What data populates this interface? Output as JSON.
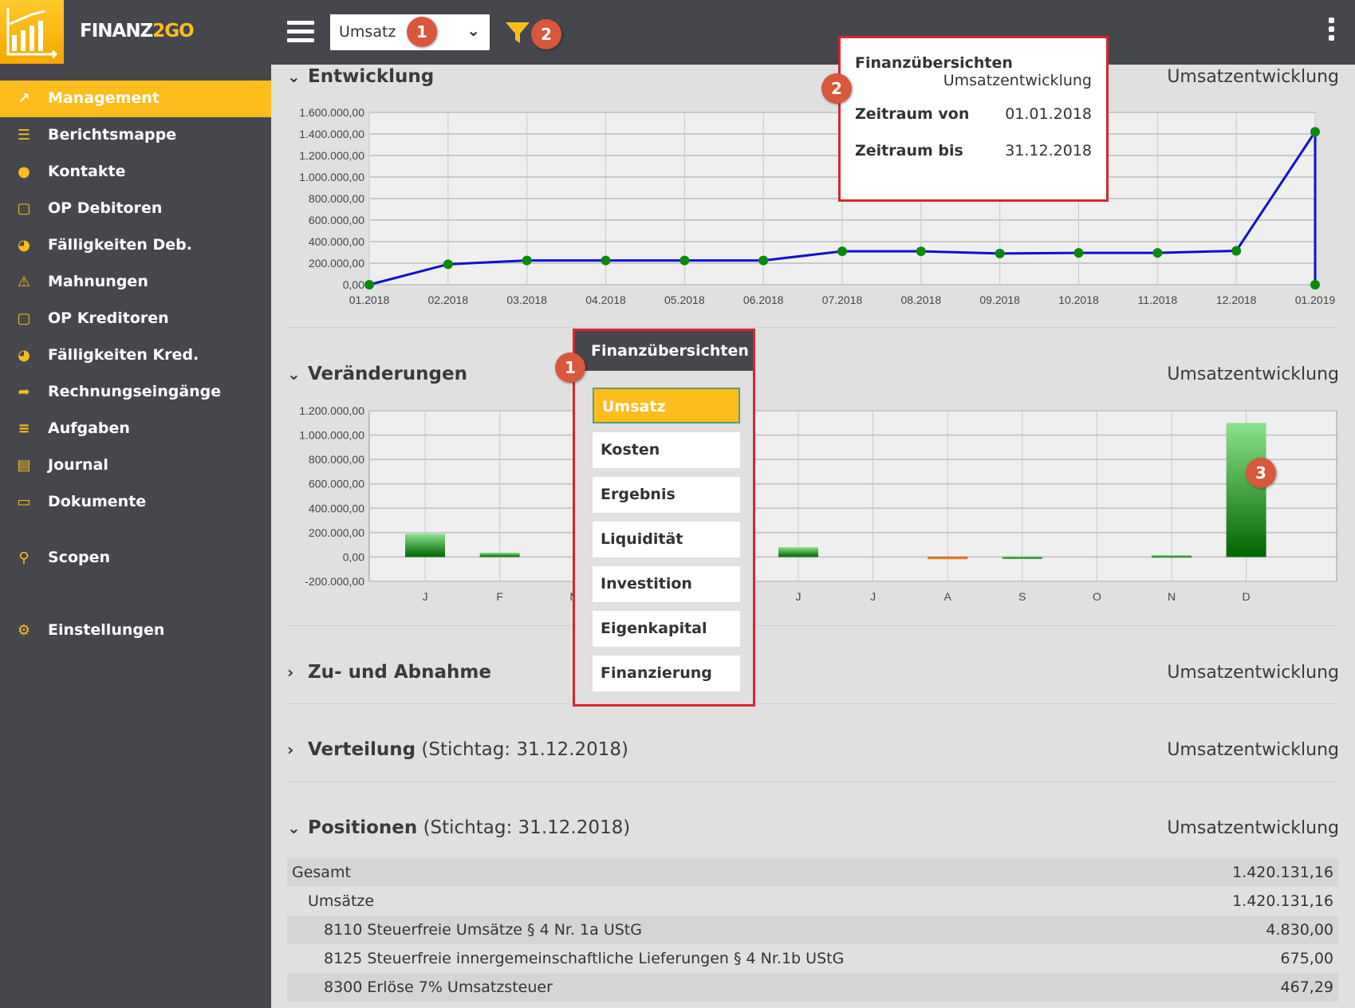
{
  "app": {
    "brand_a": "FINANZ",
    "brand_b": "2GO"
  },
  "header": {
    "select_value": "Umsatz",
    "badge_select": "1",
    "badge_filter": "2"
  },
  "colors": {
    "accent": "#fdbd1c",
    "dark": "#46474c",
    "badge": "#d9573b",
    "highlight_border": "#d62630",
    "line": "#1010d0",
    "point": "#0a8a0a"
  },
  "sidebar": {
    "items": [
      {
        "label": "Management",
        "icon": "chart-line-icon",
        "active": true
      },
      {
        "label": "Berichtsmappe",
        "icon": "list-icon"
      },
      {
        "label": "Kontakte",
        "icon": "user-icon"
      },
      {
        "label": "OP Debitoren",
        "icon": "square-icon"
      },
      {
        "label": "Fälligkeiten Deb.",
        "icon": "gauge-icon"
      },
      {
        "label": "Mahnungen",
        "icon": "warning-icon"
      },
      {
        "label": "OP Kreditoren",
        "icon": "square-icon"
      },
      {
        "label": "Fälligkeiten Kred.",
        "icon": "gauge-icon"
      },
      {
        "label": "Rechnungseingänge",
        "icon": "share-icon"
      },
      {
        "label": "Aufgaben",
        "icon": "tasks-icon"
      },
      {
        "label": "Journal",
        "icon": "journal-icon"
      },
      {
        "label": "Dokumente",
        "icon": "folder-icon"
      },
      {
        "label": "Scopen",
        "icon": "search-icon"
      },
      {
        "label": "Einstellungen",
        "icon": "gear-icon"
      }
    ]
  },
  "sections": [
    {
      "title": "Entwicklung",
      "suffix": "",
      "right": "Umsatzentwicklung",
      "expanded": true
    },
    {
      "title": "Veränderungen",
      "suffix": "",
      "right": "Umsatzentwicklung",
      "expanded": true
    },
    {
      "title": "Zu- und Abnahme",
      "suffix": "",
      "right": "Umsatzentwicklung",
      "expanded": false
    },
    {
      "title": "Verteilung",
      "suffix": " (Stichtag: 31.12.2018)",
      "right": "Umsatzentwicklung",
      "expanded": false
    },
    {
      "title": "Positionen",
      "suffix": " (Stichtag: 31.12.2018)",
      "right": "Umsatzentwicklung",
      "expanded": true
    }
  ],
  "positions": [
    {
      "label": "Gesamt",
      "value": "1.420.131,16",
      "level": 0
    },
    {
      "label": "Umsätze",
      "value": "1.420.131,16",
      "level": 1
    },
    {
      "label": "8110 Steuerfreie Umsätze § 4 Nr. 1a UStG",
      "value": "4.830,00",
      "level": 2
    },
    {
      "label": "8125 Steuerfreie innergemeinschaftliche Lieferungen § 4 Nr.1b UStG",
      "value": "675,00",
      "level": 2
    },
    {
      "label": "8300 Erlöse 7% Umsatzsteuer",
      "value": "467,29",
      "level": 2
    }
  ],
  "filter_popup": {
    "title": "Finanzübersichten",
    "subtitle": "Umsatzentwicklung",
    "from_label": "Zeitraum von",
    "from_value": "01.01.2018",
    "to_label": "Zeitraum bis",
    "to_value": "31.12.2018",
    "badge": "2"
  },
  "menu_popup": {
    "title": "Finanzübersichten",
    "badge": "1",
    "items": [
      "Umsatz",
      "Kosten",
      "Ergebnis",
      "Liquidität",
      "Investition",
      "Eigenkapital",
      "Finanzierung"
    ],
    "selected": "Umsatz"
  },
  "bar_badge": "3",
  "chart_data": [
    {
      "type": "line",
      "x": [
        "01.2018",
        "02.2018",
        "03.2018",
        "04.2018",
        "05.2018",
        "06.2018",
        "07.2018",
        "08.2018",
        "09.2018",
        "10.2018",
        "11.2018",
        "12.2018",
        "01.2019",
        "01.2019"
      ],
      "values": [
        0,
        190000,
        225000,
        225000,
        225000,
        225000,
        310000,
        310000,
        290000,
        295000,
        295000,
        315000,
        1420131,
        0
      ],
      "ylim": [
        0,
        1600000
      ],
      "yticks": [
        "0,00",
        "200.000,00",
        "400.000,00",
        "600.000,00",
        "800.000,00",
        "1.000.000,00",
        "1.200.000,00",
        "1.400.000,00",
        "1.600.000,00"
      ],
      "xticks": [
        "01.2018",
        "02.2018",
        "03.2018",
        "04.2018",
        "05.2018",
        "06.2018",
        "07.2018",
        "08.2018",
        "09.2018",
        "10.2018",
        "11.2018",
        "12.2018",
        "01.2019"
      ],
      "grid": true
    },
    {
      "type": "bar",
      "categories": [
        "J",
        "F",
        "M",
        "A",
        "M",
        "J",
        "J",
        "A",
        "S",
        "O",
        "N",
        "D"
      ],
      "values": [
        190000,
        35000,
        null,
        null,
        null,
        80000,
        0,
        -15000,
        5000,
        0,
        15000,
        1100000
      ],
      "ylim": [
        -200000,
        1200000
      ],
      "yticks": [
        "-200.000,00",
        "0,00",
        "200.000,00",
        "400.000,00",
        "600.000,00",
        "800.000,00",
        "1.000.000,00",
        "1.200.000,00"
      ],
      "grid": true
    }
  ]
}
